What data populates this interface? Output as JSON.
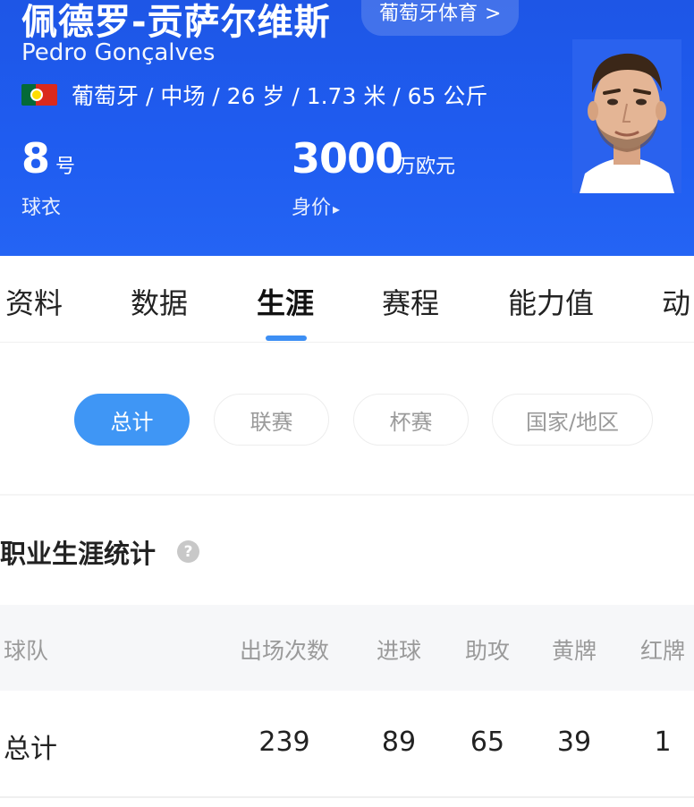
{
  "player": {
    "name_cn": "佩德罗-贡萨尔维斯",
    "name_en": "Pedro Gonçalves",
    "source_chip": "葡萄牙体育",
    "source_chevron": ">",
    "bio": "葡萄牙 / 中场 / 26 岁 / 1.73 米 / 65 公斤",
    "flag": "portugal-flag"
  },
  "stats": {
    "shirt_number": "8",
    "shirt_unit": "号",
    "shirt_caption": "球衣",
    "value_number": "3000",
    "value_unit": "万欧元",
    "value_caption": "身价",
    "value_arrow": "▸"
  },
  "tabs": [
    {
      "label": "资料"
    },
    {
      "label": "数据"
    },
    {
      "label": "生涯",
      "active": true
    },
    {
      "label": "赛程"
    },
    {
      "label": "能力值"
    },
    {
      "label": "动"
    }
  ],
  "filters": [
    {
      "label": "总计",
      "active": true
    },
    {
      "label": "联赛"
    },
    {
      "label": "杯赛"
    },
    {
      "label": "国家/地区"
    }
  ],
  "career": {
    "title": "职业生涯统计",
    "help_icon": "question-icon",
    "help_glyph": "?",
    "columns": [
      "球队",
      "出场次数",
      "进球",
      "助攻",
      "黄牌",
      "红牌"
    ],
    "rows": [
      {
        "team": "总计",
        "apps": "239",
        "goals": "89",
        "assists": "65",
        "yellow": "39",
        "red": "1"
      }
    ]
  },
  "colors": {
    "header_blue": "#1f5cf0",
    "accent_blue": "#3f96f5",
    "muted_text": "#9a9a9a"
  }
}
